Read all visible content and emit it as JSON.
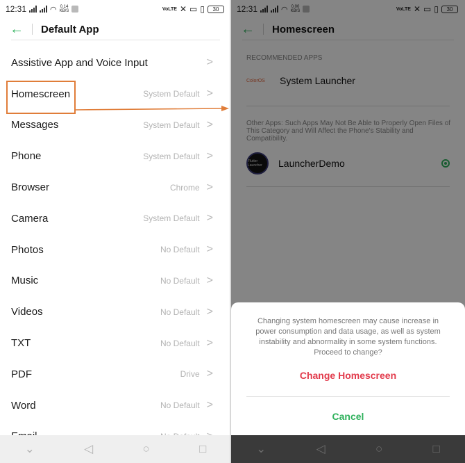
{
  "left": {
    "status": {
      "time": "12:31",
      "speed": "0.14\nKB/S",
      "battery": "30"
    },
    "header": {
      "title": "Default App"
    },
    "rows": [
      {
        "label": "Assistive App and Voice Input",
        "value": ""
      },
      {
        "label": "Homescreen",
        "value": "System Default"
      },
      {
        "label": "Messages",
        "value": "System Default"
      },
      {
        "label": "Phone",
        "value": "System Default"
      },
      {
        "label": "Browser",
        "value": "Chrome"
      },
      {
        "label": "Camera",
        "value": "System Default"
      },
      {
        "label": "Photos",
        "value": "No Default"
      },
      {
        "label": "Music",
        "value": "No Default"
      },
      {
        "label": "Videos",
        "value": "No Default"
      },
      {
        "label": "TXT",
        "value": "No Default"
      },
      {
        "label": "PDF",
        "value": "Drive"
      },
      {
        "label": "Word",
        "value": "No Default"
      },
      {
        "label": "Email",
        "value": "No Default"
      }
    ]
  },
  "right": {
    "status": {
      "time": "12:31",
      "speed": "0.00\nKB/S",
      "battery": "30"
    },
    "header": {
      "title": "Homescreen"
    },
    "recommended_label": "RECOMMENDED APPS",
    "recommended_app": {
      "logo": "ColorOS",
      "name": "System Launcher"
    },
    "other_label": "Other Apps: Such Apps May Not Be Able to Properly Open Files of This Category and Will Affect the Phone's Stability and Compatibility.",
    "other_app": {
      "name": "LauncherDemo",
      "avatar_text": "Flutter Launcher",
      "selected": true
    },
    "dialog": {
      "message": "Changing system homescreen may cause increase in power consumption and data usage, as well as system instability and abnormality in some system functions. Proceed to change?",
      "confirm": "Change Homescreen",
      "cancel": "Cancel"
    }
  },
  "colors": {
    "accent_green": "#2fb15c",
    "danger_red": "#e23b4c",
    "annotation_orange": "#e07d39"
  },
  "icons": [
    "back-arrow-icon",
    "chevron-right-icon",
    "nav-back-icon",
    "nav-home-icon",
    "nav-recents-icon"
  ]
}
